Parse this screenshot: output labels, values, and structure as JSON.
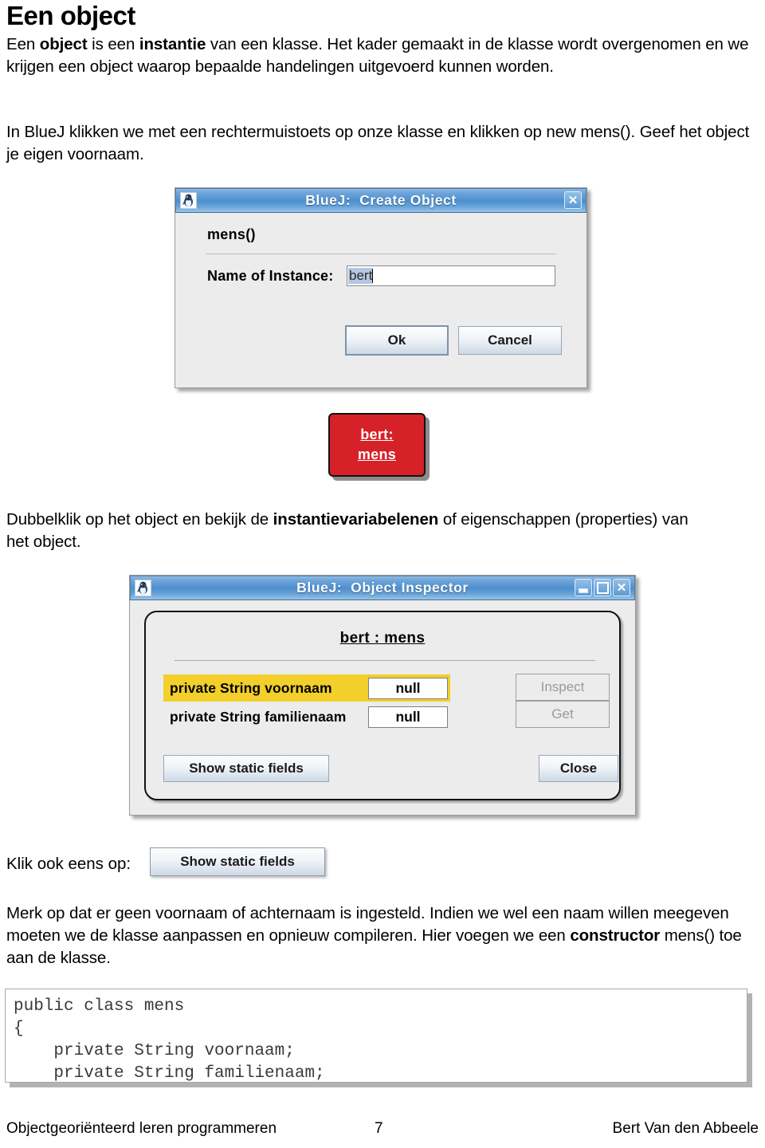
{
  "document": {
    "heading": "Een object",
    "paragraph_1": {
      "segments": [
        {
          "text": "Een ",
          "bold": false
        },
        {
          "text": "object",
          "bold": true
        },
        {
          "text": " is een ",
          "bold": false
        },
        {
          "text": "instantie",
          "bold": true
        },
        {
          "text": " van een klasse. Het kader gemaakt in de klasse wordt overgenomen en we krijgen een object waarop bepaalde handelingen uitgevoerd kunnen worden.",
          "bold": false
        }
      ]
    },
    "paragraph_2": {
      "segments": [
        {
          "text": "In BlueJ klikken we met een rechtermuistoets op onze klasse en klikken op new mens(). Geef het object je eigen voornaam.",
          "bold": false
        }
      ]
    },
    "paragraph_3": {
      "segments": [
        {
          "text": "Dubbelklik op het object en bekijk de ",
          "bold": false
        },
        {
          "text": "instantievariabelenen",
          "bold": true
        },
        {
          "text": " of eigenschappen (properties) van het object.",
          "bold": false
        }
      ]
    },
    "klik_label": "Klik ook eens op:",
    "paragraph_5": {
      "segments": [
        {
          "text": "Merk op dat er geen voornaam of achternaam is ingesteld. Indien we wel een naam willen meegeven moeten we de klasse aanpassen en opnieuw compileren. Hier voegen we een ",
          "bold": false
        },
        {
          "text": "constructor",
          "bold": true
        },
        {
          "text": " mens() toe aan de klasse.",
          "bold": false
        }
      ]
    },
    "code_block": "public class mens\n{\n    private String voornaam;\n    private String familienaam;"
  },
  "create_object_dialog": {
    "title": "BlueJ:  Create Object",
    "app_icon": "bluej-penguin-icon",
    "close_button_label": "✕",
    "signature": "mens()",
    "instance_label": "Name of Instance:",
    "instance_value": "bert",
    "instance_value_selected": true,
    "ok_label": "Ok",
    "cancel_label": "Cancel"
  },
  "object_icon": {
    "line1": "bert:",
    "line2": "mens",
    "color": "#d72128",
    "text_color": "#ffffff"
  },
  "object_inspector_dialog": {
    "title": "BlueJ:  Object Inspector",
    "app_icon": "bluej-penguin-icon",
    "minimize_label": "–",
    "maximize_label": "□",
    "close_button_label": "✕",
    "heading": "bert : mens",
    "fields": [
      {
        "name": "private String voornaam",
        "value": "null",
        "highlighted": true,
        "highlight_color": "#f2cf2a"
      },
      {
        "name": "private String familienaam",
        "value": "null",
        "highlighted": false,
        "highlight_color": ""
      }
    ],
    "inspect_label": "Inspect",
    "inspect_disabled": true,
    "get_label": "Get",
    "get_disabled": true,
    "show_static_fields_label": "Show static fields",
    "close_label": "Close"
  },
  "inline_button": {
    "label": "Show static fields"
  },
  "footer": {
    "left": "Objectgeoriënteerd leren programmeren",
    "page_number": "7",
    "right": "Bert Van den Abbeele"
  }
}
